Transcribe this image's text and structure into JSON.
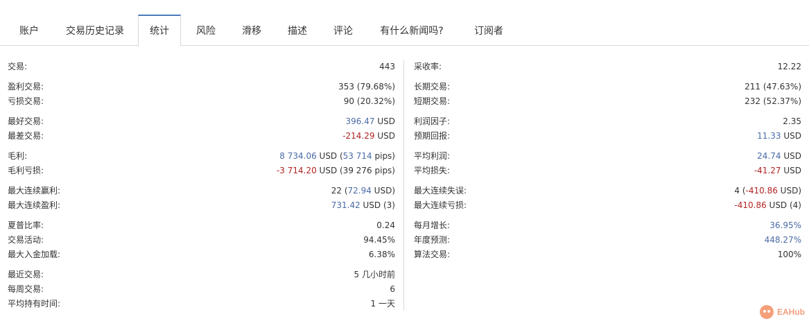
{
  "tabs": [
    {
      "label": "账户"
    },
    {
      "label": "交易历史记录"
    },
    {
      "label": "统计"
    },
    {
      "label": "风险"
    },
    {
      "label": "滑移"
    },
    {
      "label": "描述"
    },
    {
      "label": "评论"
    },
    {
      "label": "有什么新闻吗?"
    },
    {
      "label": "订阅者"
    }
  ],
  "active_tab": "统计",
  "colors": {
    "link_blue": "#4a6aa5",
    "negative_red": "#b22222",
    "active_tab_border": "#4a7ab8"
  },
  "left": {
    "g1": {
      "trades": {
        "label": "交易:",
        "value": "443"
      }
    },
    "g2": {
      "profit_trades": {
        "label": "盈利交易:",
        "value": "353 (79.68%)"
      },
      "loss_trades": {
        "label": "亏损交易:",
        "value": "90 (20.32%)"
      }
    },
    "g3": {
      "best_trade": {
        "label": "最好交易:",
        "amount": "396.47",
        "suffix": " USD"
      },
      "worst_trade": {
        "label": "最差交易:",
        "amount": "-214.29",
        "suffix": " USD"
      }
    },
    "g4": {
      "gross_profit": {
        "label": "毛利:",
        "amount": "8 734.06",
        "mid": " USD (",
        "pips": "53 714",
        "suffix": " pips)"
      },
      "gross_loss": {
        "label": "毛利亏损:",
        "amount": "-3 714.20",
        "mid": " USD (39 276 pips)"
      }
    },
    "g5": {
      "max_consec_wins": {
        "label": "最大连续赢利:",
        "prefix": "22 (",
        "amount": "72.94",
        "suffix": " USD)"
      },
      "max_consec_profit": {
        "label": "最大连续盈利:",
        "amount": "731.42",
        "suffix": " USD (3)"
      }
    },
    "g6": {
      "sharpe": {
        "label": "夏普比率:",
        "value": "0.24"
      },
      "activity": {
        "label": "交易活动:",
        "value": "94.45%"
      },
      "max_deposit_load": {
        "label": "最大入金加载:",
        "value": "6.38%"
      }
    },
    "g7": {
      "latest_trade": {
        "label": "最近交易:",
        "value": "5 几小时前"
      },
      "trades_per_week": {
        "label": "每周交易:",
        "value": "6"
      },
      "avg_holding": {
        "label": "平均持有时间:",
        "value": "1 一天"
      }
    }
  },
  "right": {
    "g1": {
      "recovery": {
        "label": "采收率:",
        "value": "12.22"
      }
    },
    "g2": {
      "long_trades": {
        "label": "长期交易:",
        "value": "211 (47.63%)"
      },
      "short_trades": {
        "label": "短期交易:",
        "value": "232 (52.37%)"
      }
    },
    "g3": {
      "profit_factor": {
        "label": "利润因子:",
        "value": "2.35"
      },
      "expected_payoff": {
        "label": "预期回报:",
        "amount": "11.33",
        "suffix": " USD"
      }
    },
    "g4": {
      "avg_profit": {
        "label": "平均利润:",
        "amount": "24.74",
        "suffix": " USD"
      },
      "avg_loss": {
        "label": "平均损失:",
        "amount": "-41.27",
        "suffix": " USD"
      }
    },
    "g5": {
      "max_consec_losses": {
        "label": "最大连续失误:",
        "prefix": "4 (",
        "amount": "-410.86",
        "suffix": " USD)"
      },
      "max_consec_loss": {
        "label": "最大连续亏损:",
        "amount": "-410.86",
        "suffix": " USD (4)"
      }
    },
    "g6": {
      "monthly_growth": {
        "label": "每月增长:",
        "value": "36.95%"
      },
      "annual_forecast": {
        "label": "年度预测:",
        "value": "448.27%"
      },
      "algo_trading": {
        "label": "算法交易:",
        "value": "100%"
      }
    }
  },
  "brand": {
    "text": "EAHub"
  }
}
